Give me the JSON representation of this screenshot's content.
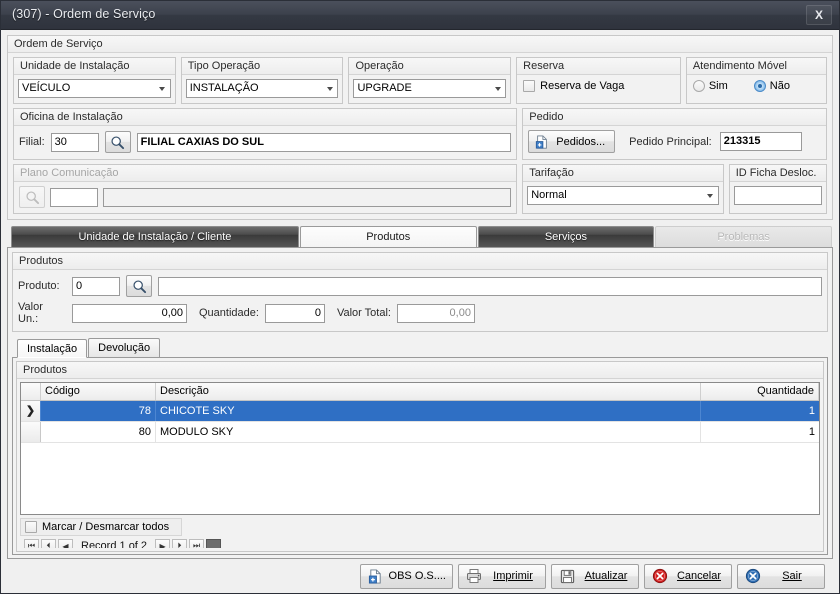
{
  "window": {
    "title": "(307) - Ordem de Serviço",
    "close_label": "X"
  },
  "os_group": {
    "caption": "Ordem de Serviço"
  },
  "unidade_instalacao": {
    "caption": "Unidade de Instalação",
    "value": "VEÍCULO"
  },
  "tipo_operacao": {
    "caption": "Tipo Operação",
    "value": "INSTALAÇÃO"
  },
  "operacao": {
    "caption": "Operação",
    "value": "UPGRADE"
  },
  "reserva": {
    "caption": "Reserva",
    "checkbox_label": "Reserva de Vaga",
    "checked": false
  },
  "atendimento_movel": {
    "caption": "Atendimento Móvel",
    "option_sim": "Sim",
    "option_nao": "Não",
    "selected": "Não"
  },
  "oficina": {
    "caption": "Oficina de Instalação",
    "filial_label": "Filial:",
    "filial_code": "30",
    "search_icon": "magnifier-icon",
    "filial_name": "FILIAL CAXIAS DO SUL"
  },
  "pedido": {
    "caption": "Pedido",
    "button_label": "Pedidos...",
    "button_icon": "document-add-icon",
    "principal_label": "Pedido Principal:",
    "principal_value": "213315"
  },
  "plano_comunicacao": {
    "caption": "Plano Comunicação",
    "search_icon": "magnifier-icon",
    "code": "",
    "description": "",
    "disabled": true
  },
  "tarifacao": {
    "caption": "Tarifação",
    "value": "Normal"
  },
  "id_ficha": {
    "caption": "ID Ficha Desloc.",
    "value": ""
  },
  "main_tabs": [
    {
      "label": "Unidade de Instalação / Cliente",
      "state": "normal"
    },
    {
      "label": "Produtos",
      "state": "active"
    },
    {
      "label": "Serviços",
      "state": "normal"
    },
    {
      "label": "Problemas",
      "state": "disabled"
    }
  ],
  "produtos_panel": {
    "caption": "Produtos",
    "produto_label": "Produto:",
    "produto_code": "0",
    "search_icon": "magnifier-icon",
    "produto_desc": "",
    "valor_un_label": "Valor Un.:",
    "valor_un": "0,00",
    "quantidade_label": "Quantidade:",
    "quantidade": "0",
    "valor_total_label": "Valor Total:",
    "valor_total": "0,00"
  },
  "sub_tabs": [
    {
      "label": "Instalação",
      "state": "active"
    },
    {
      "label": "Devolução",
      "state": "normal"
    }
  ],
  "grid_panel": {
    "caption": "Produtos",
    "columns": [
      "",
      "Código",
      "Descrição",
      "Quantidade"
    ],
    "rows": [
      {
        "indicator": "❯",
        "codigo": "78",
        "descricao": "CHICOTE SKY",
        "quantidade": "1",
        "selected": true
      },
      {
        "indicator": "",
        "codigo": "80",
        "descricao": "MODULO SKY",
        "quantidade": "1",
        "selected": false
      }
    ],
    "marcar_label": "Marcar / Desmarcar todos",
    "marcar_checked": false,
    "navigator_text": "Record 1 of 2"
  },
  "bottom_buttons": [
    {
      "label": "OBS O.S....",
      "icon": "document-add-icon",
      "accel": ""
    },
    {
      "label": "Imprimir",
      "icon": "printer-icon",
      "accel": "I"
    },
    {
      "label": "Atualizar",
      "icon": "save-disk-icon",
      "accel": "A"
    },
    {
      "label": "Cancelar",
      "icon": "cancel-circle-icon",
      "accel": "C"
    },
    {
      "label": "Sair",
      "icon": "exit-circle-icon",
      "accel": "S"
    }
  ],
  "colors": {
    "titlebar": "#3a3f4a",
    "selection": "#2f6fc4",
    "cancel_red": "#cc2222",
    "exit_blue": "#2f6fb5",
    "face": "#f0f0f0"
  }
}
